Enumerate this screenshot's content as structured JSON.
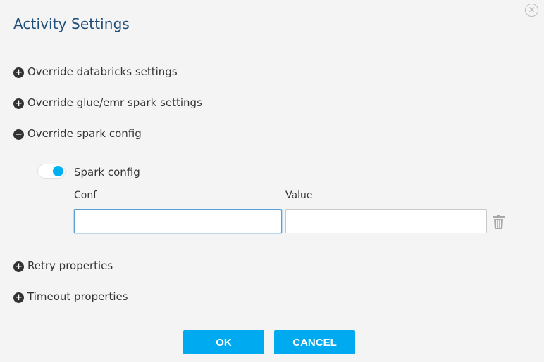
{
  "dialog": {
    "title": "Activity Settings",
    "close_icon": "close-circle-icon"
  },
  "sections": [
    {
      "label": "Override databricks settings",
      "expanded": false
    },
    {
      "label": "Override glue/emr spark settings",
      "expanded": false
    },
    {
      "label": "Override spark config",
      "expanded": true
    },
    {
      "label": "Retry properties",
      "expanded": false
    },
    {
      "label": "Timeout properties",
      "expanded": false
    }
  ],
  "icons": {
    "expand": "+",
    "collapse": "−"
  },
  "spark_config": {
    "toggle_label": "Spark config",
    "toggle_on": true,
    "conf_label": "Conf",
    "value_label": "Value",
    "conf_value": "",
    "value_value": ""
  },
  "buttons": {
    "ok": "OK",
    "cancel": "CANCEL"
  },
  "colors": {
    "accent": "#00aaf0",
    "title": "#1f4e79",
    "toggle_knob": "#00b0f0"
  }
}
